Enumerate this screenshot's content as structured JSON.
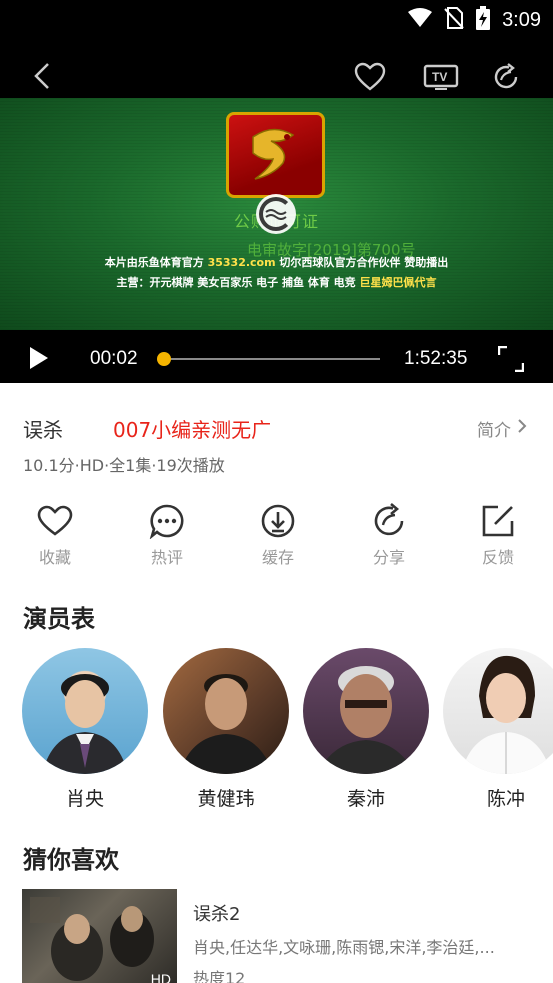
{
  "status_bar": {
    "time": "3:09"
  },
  "video": {
    "watermark_line1": "公购证可证",
    "watermark_line2": "电审故字[2019]第700号",
    "caption1_pre": "本片由乐鱼体育官方",
    "caption1_url": "35332.com",
    "caption1_post": "切尔西球队官方合作伙伴 赞助播出",
    "caption2_pre": "主营：开元棋牌 美女百家乐 电子 捕鱼 体育 电竞",
    "caption2_hl": "巨星姆巴佩代言"
  },
  "controls": {
    "current_time": "00:02",
    "duration": "1:52:35",
    "progress": 0.0003
  },
  "info": {
    "title": "误杀",
    "promo": "007小编亲测无广",
    "intro_label": "简介",
    "meta": "10.1分·HD·全1集·19次播放"
  },
  "actions": [
    {
      "label": "收藏",
      "icon": "heart-icon"
    },
    {
      "label": "热评",
      "icon": "comment-icon"
    },
    {
      "label": "缓存",
      "icon": "download-icon"
    },
    {
      "label": "分享",
      "icon": "share-icon"
    },
    {
      "label": "反馈",
      "icon": "feedback-icon"
    }
  ],
  "cast_section": {
    "title": "演员表",
    "actors": [
      {
        "name": "肖央"
      },
      {
        "name": "黄健玮"
      },
      {
        "name": "秦沛"
      },
      {
        "name": "陈冲"
      }
    ]
  },
  "recommend_section": {
    "title": "猜你喜欢",
    "items": [
      {
        "title": "误杀2",
        "cast": "肖央,任达华,文咏珊,陈雨锶,宋洋,李治廷,...",
        "hot": "热度12",
        "badge": "HD"
      }
    ]
  },
  "colors": {
    "accent": "#f5b400",
    "promo": "#e8241a",
    "video_bg": "#1b6a2c"
  }
}
